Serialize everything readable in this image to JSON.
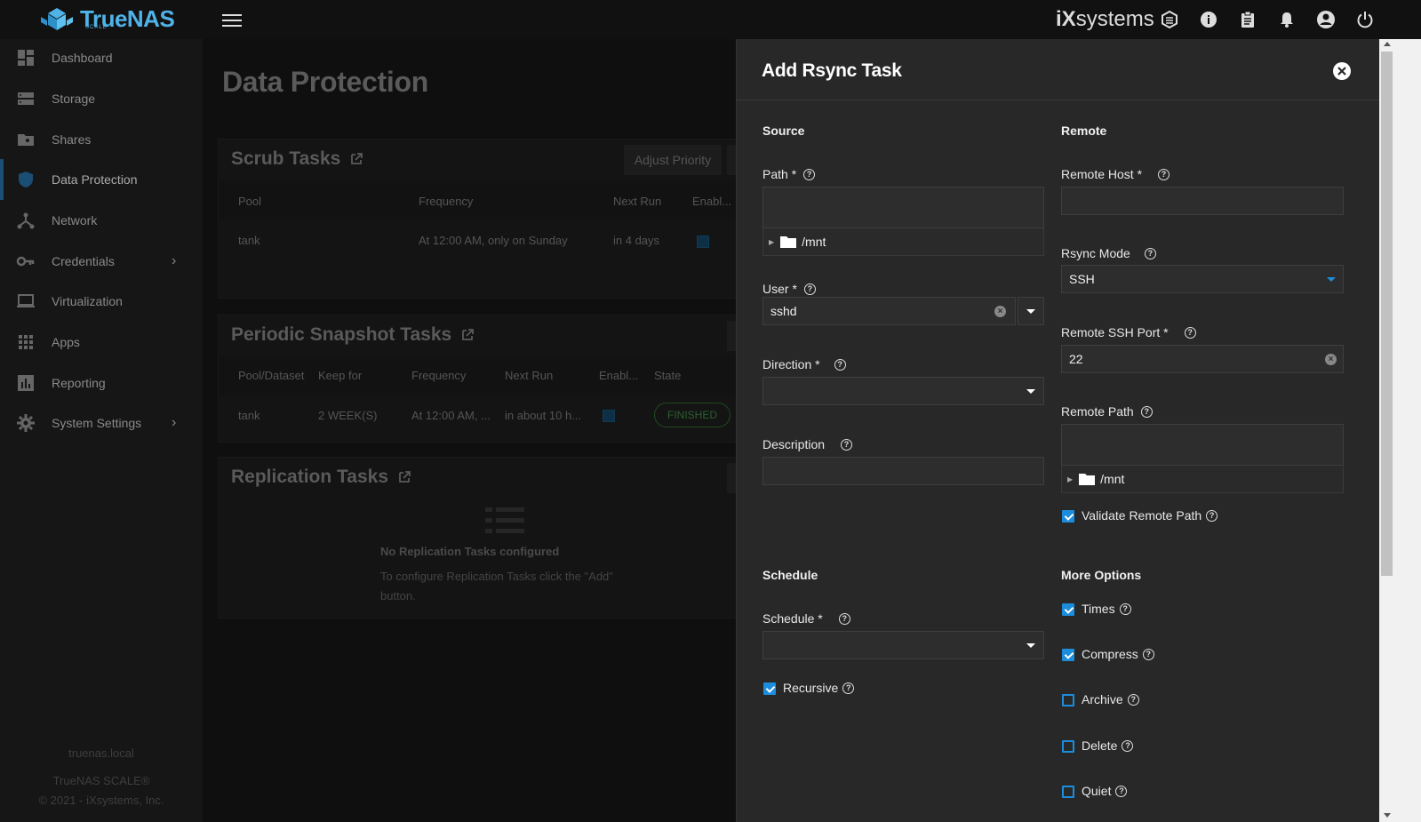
{
  "app": {
    "brand": "TrueNAS",
    "brand_sub": "SCALE",
    "vendor_logo_prefix": "iX",
    "vendor_logo": "systems"
  },
  "topbar": {
    "icons": [
      "truecommand-icon",
      "info-icon",
      "clipboard-icon",
      "bell-icon",
      "account-icon",
      "power-icon"
    ]
  },
  "sidebar": {
    "items": [
      {
        "label": "Dashboard",
        "icon": "dashboard-icon"
      },
      {
        "label": "Storage",
        "icon": "storage-icon"
      },
      {
        "label": "Shares",
        "icon": "shares-icon"
      },
      {
        "label": "Data Protection",
        "icon": "shield-icon"
      },
      {
        "label": "Network",
        "icon": "network-icon"
      },
      {
        "label": "Credentials",
        "icon": "key-icon"
      },
      {
        "label": "Virtualization",
        "icon": "laptop-icon"
      },
      {
        "label": "Apps",
        "icon": "apps-icon"
      },
      {
        "label": "Reporting",
        "icon": "reporting-icon"
      },
      {
        "label": "System Settings",
        "icon": "gear-icon"
      }
    ],
    "hostname": "truenas.local",
    "product": "TrueNAS SCALE®",
    "copyright": "© 2021 - iXsystems, Inc."
  },
  "main": {
    "title": "Data Protection",
    "scrub": {
      "title": "Scrub Tasks",
      "adjust_btn": "Adjust Priority",
      "headers": [
        "Pool",
        "Frequency",
        "Next Run",
        "Enabl..."
      ],
      "row": {
        "pool": "tank",
        "frequency": "At 12:00 AM, only on Sunday",
        "next_run": "in 4 days"
      }
    },
    "snapshot": {
      "title": "Periodic Snapshot Tasks",
      "headers": [
        "Pool/Dataset",
        "Keep for",
        "Frequency",
        "Next Run",
        "Enabl...",
        "State"
      ],
      "row": {
        "pool": "tank",
        "keep": "2 WEEK(S)",
        "frequency": "At 12:00 AM, ...",
        "next_run": "in about 10 h...",
        "state": "FINISHED"
      }
    },
    "replication": {
      "title": "Replication Tasks",
      "empty_title": "No Replication Tasks configured",
      "empty_text_1": "To configure Replication Tasks click the \"Add\"",
      "empty_text_2": "button."
    }
  },
  "panel": {
    "title": "Add Rsync Task",
    "source": {
      "heading": "Source",
      "path_label": "Path *",
      "path_tree": "/mnt",
      "user_label": "User *",
      "user_value": "sshd",
      "direction_label": "Direction *",
      "description_label": "Description"
    },
    "remote": {
      "heading": "Remote",
      "host_label": "Remote Host *",
      "mode_label": "Rsync Mode",
      "mode_value": "SSH",
      "port_label": "Remote SSH Port *",
      "port_value": "22",
      "path_label": "Remote Path",
      "path_tree": "/mnt",
      "validate_label": "Validate Remote Path"
    },
    "schedule": {
      "heading": "Schedule",
      "schedule_label": "Schedule *",
      "recursive_label": "Recursive"
    },
    "more": {
      "heading": "More Options",
      "times": "Times",
      "compress": "Compress",
      "archive": "Archive",
      "delete": "Delete",
      "quiet": "Quiet"
    }
  },
  "colors": {
    "accent": "#1c8ddc",
    "brand": "#4fb3e8",
    "panel_bg": "#282828"
  }
}
